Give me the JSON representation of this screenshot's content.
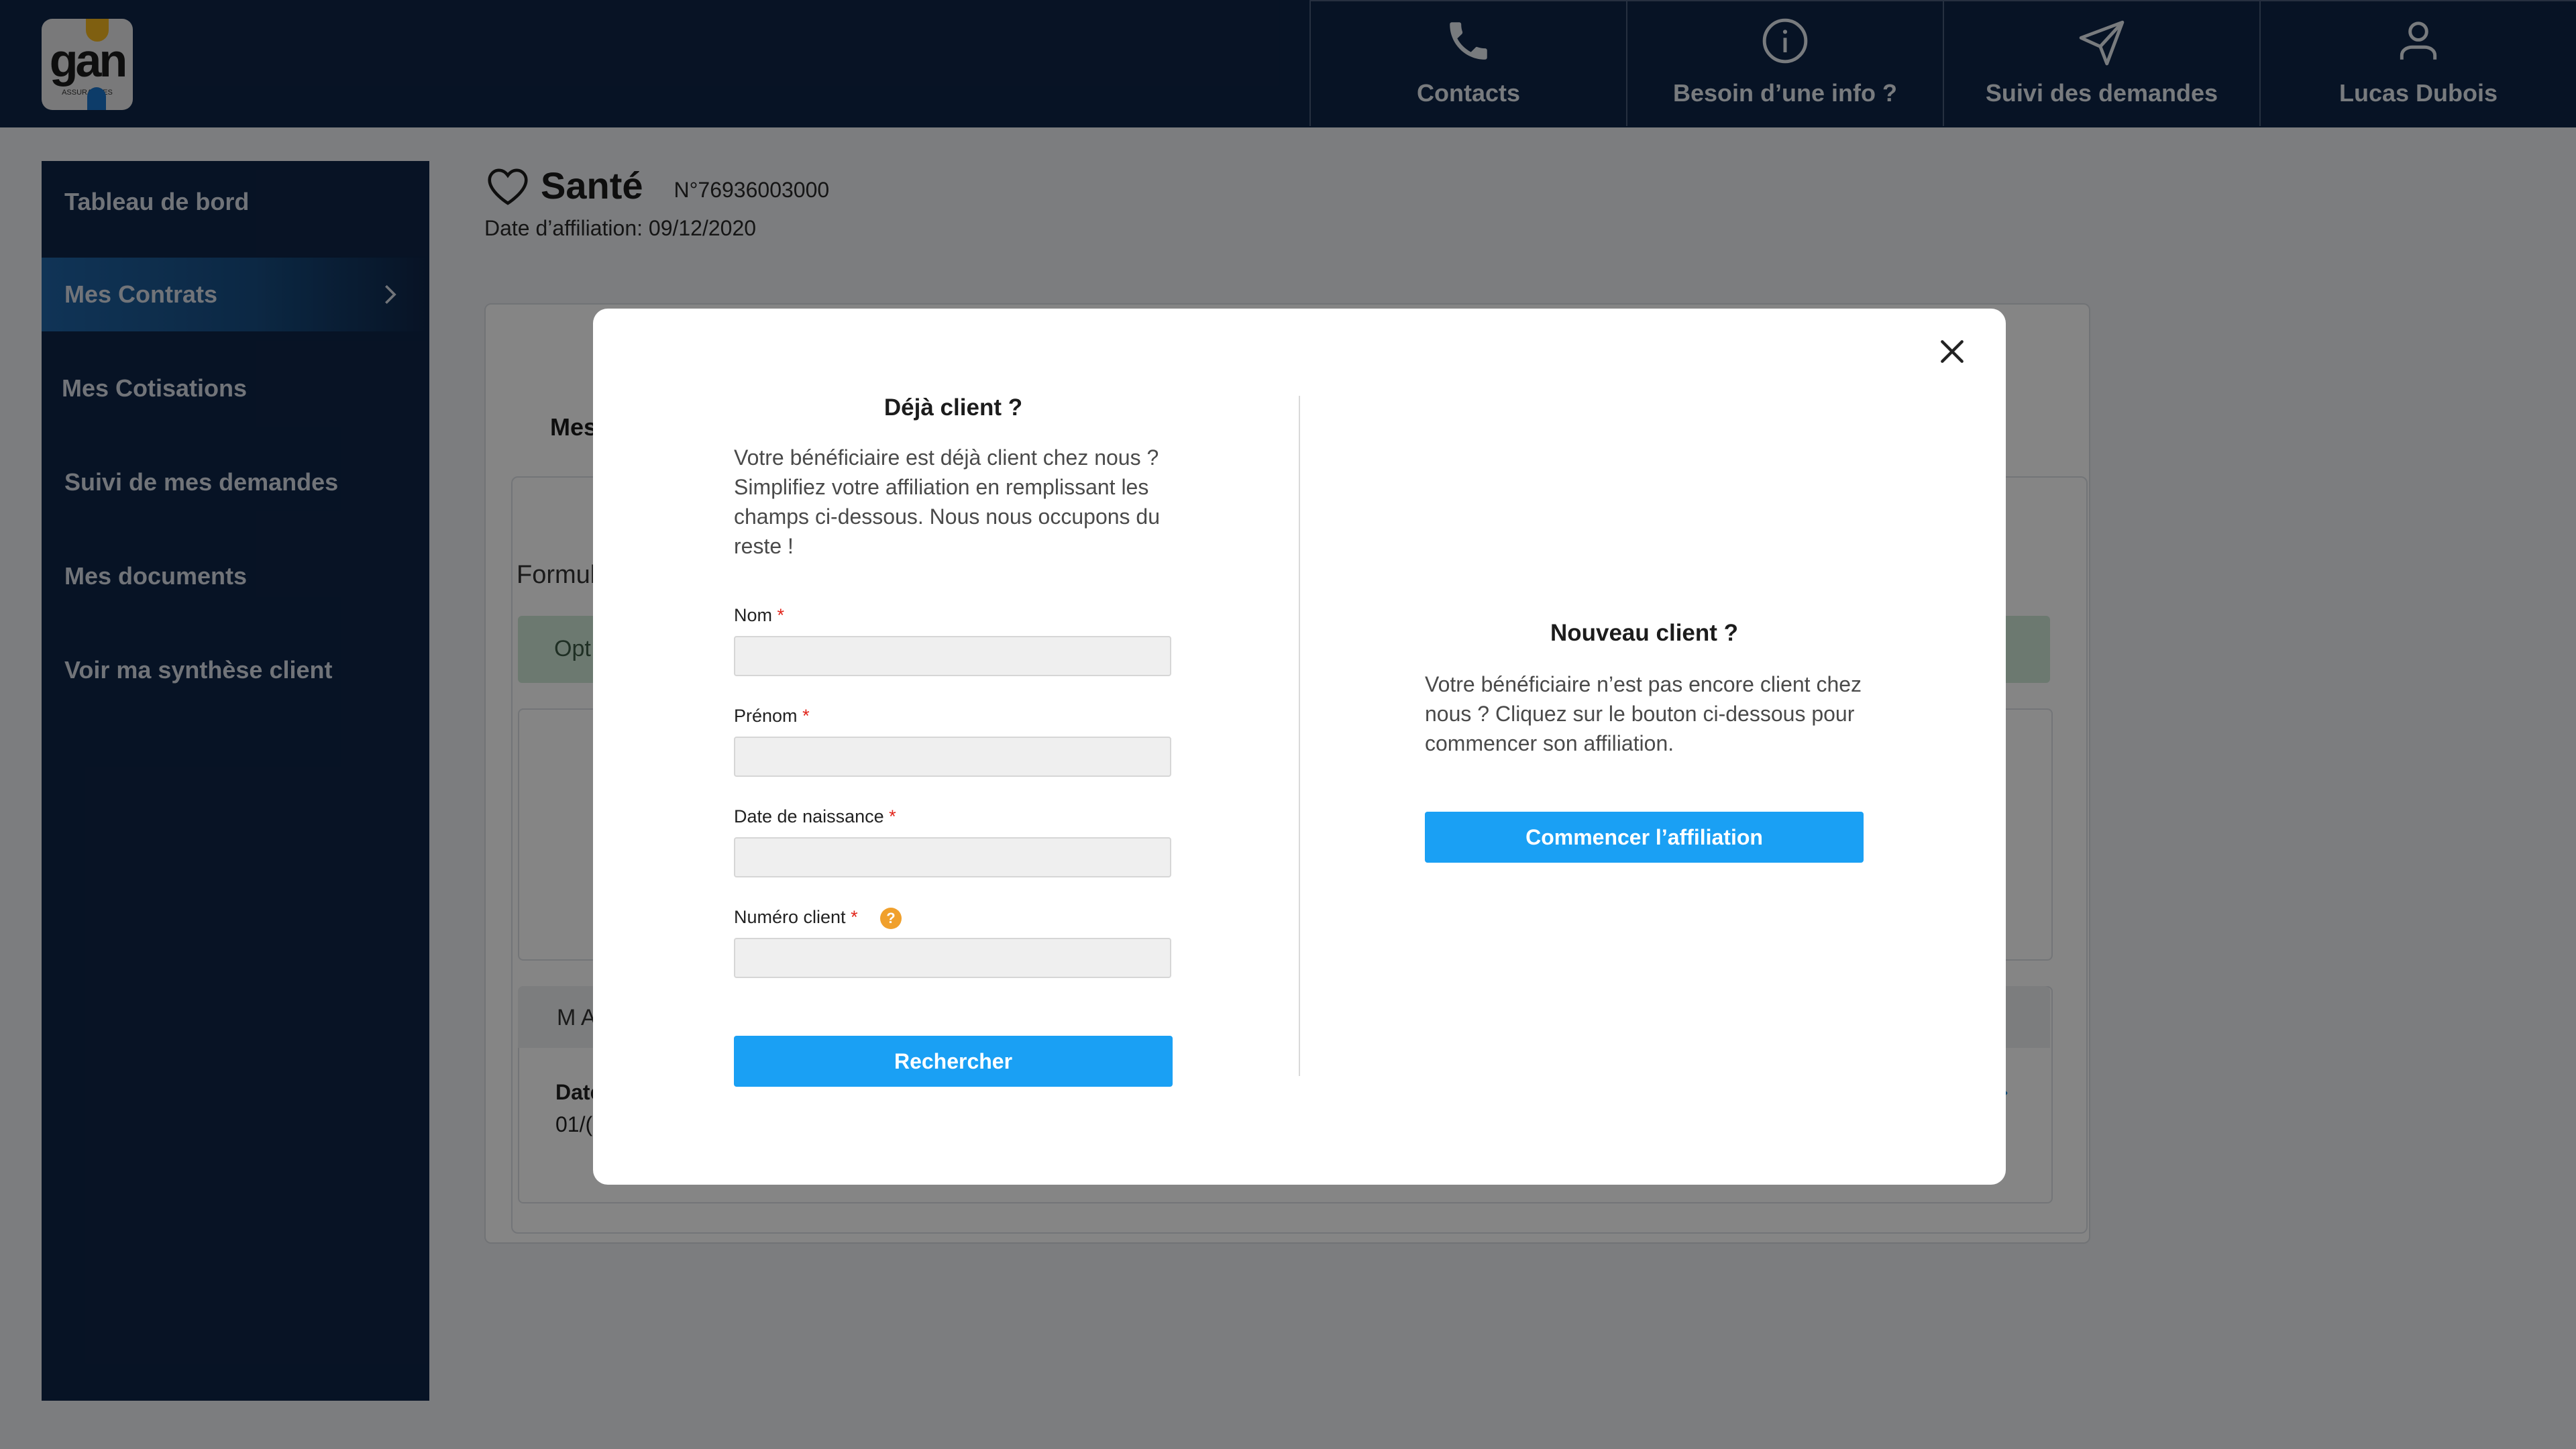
{
  "header": {
    "logo_text": "gan",
    "logo_subtext": "ASSURANCES",
    "nav": [
      {
        "icon": "phone-icon",
        "label": "Contacts"
      },
      {
        "icon": "info-icon",
        "label": "Besoin d’une info ?"
      },
      {
        "icon": "send-icon",
        "label": "Suivi des demandes"
      },
      {
        "icon": "user-icon",
        "label": "Lucas Dubois"
      }
    ]
  },
  "sidebar": {
    "items": [
      {
        "label": "Tableau de bord"
      },
      {
        "label": "Mes Contrats"
      },
      {
        "label": "Mes Cotisations"
      },
      {
        "label": "Suivi de mes demandes"
      },
      {
        "label": "Mes documents"
      },
      {
        "label": "Voir ma synthèse client"
      }
    ]
  },
  "page": {
    "title": "Santé",
    "contract_number": "N°76936003000",
    "affiliation_date": "Date d’affiliation: 09/12/2020",
    "fragments": {
      "mes": "Mes",
      "formul": "Formul",
      "opt": "Opt",
      "ma": "M A",
      "date": "Date",
      "date_value": "01/("
    }
  },
  "modal": {
    "left": {
      "title": "Déjà client ?",
      "text": "Votre bénéficiaire est déjà client chez nous ? Simplifiez votre affiliation en remplissant les champs ci-dessous. Nous nous occupons du reste !",
      "fields": [
        {
          "label": "Nom",
          "value": "",
          "placeholder": ""
        },
        {
          "label": "Prénom",
          "value": "",
          "placeholder": ""
        },
        {
          "label": "Date de naissance",
          "value": "",
          "placeholder": ""
        },
        {
          "label": "Numéro client",
          "value": "",
          "placeholder": ""
        }
      ],
      "required_mark": "*",
      "help_glyph": "?",
      "search_button": "Rechercher"
    },
    "right": {
      "title": "Nouveau client ?",
      "text": "Votre bénéficiaire n’est pas encore client chez nous ? Cliquez sur le bouton ci-dessous pour commencer son affiliation.",
      "start_button": "Commencer l’affiliation"
    }
  },
  "colors": {
    "navy": "#0f2547",
    "accent_blue": "#1aa0f4",
    "required_red": "#e1251b",
    "help_orange": "#f0a02c"
  }
}
